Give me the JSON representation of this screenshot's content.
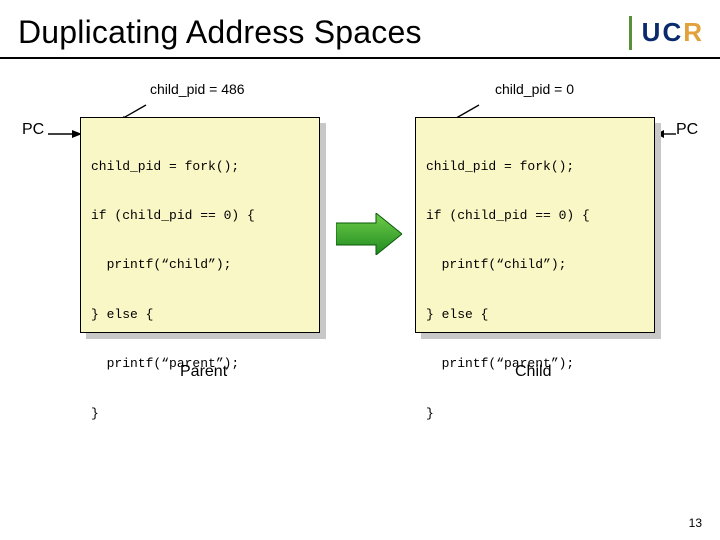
{
  "title": "Duplicating Address Spaces",
  "logo": {
    "u": "U",
    "c": "C",
    "r": "R"
  },
  "pid_label_left": "child_pid = 486",
  "pid_label_right": "child_pid = 0",
  "pc_label": "PC",
  "code": {
    "l1": "child_pid = fork();",
    "l2": "if (child_pid == 0) {",
    "l3": "  printf(“child”);",
    "l4": "} else {",
    "l5": "  printf(“parent”);",
    "l6": "}"
  },
  "caption_left": "Parent",
  "caption_right": "Child",
  "slide_number": "13"
}
